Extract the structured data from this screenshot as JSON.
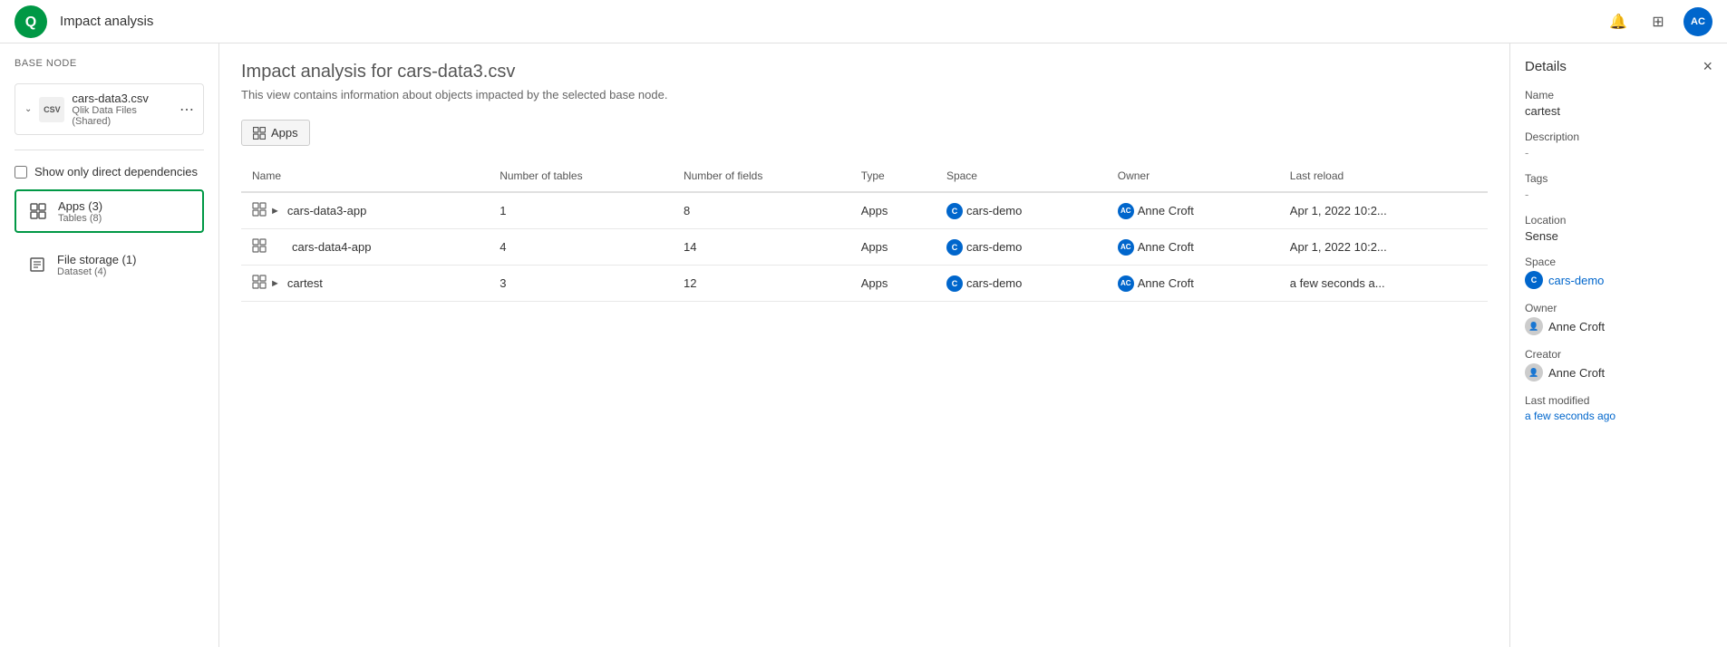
{
  "app": {
    "title": "Impact analysis"
  },
  "topnav": {
    "logo_alt": "Qlik",
    "title": "Impact analysis",
    "avatar_initials": "AC"
  },
  "sidebar": {
    "base_node_label": "Base node",
    "base_node_name": "cars-data3.csv",
    "base_node_sub": "Qlik Data Files (Shared)",
    "checkbox_label": "Show only direct dependencies",
    "nav_items": [
      {
        "title": "Apps  (3)",
        "sub": "Tables (8)",
        "active": true
      },
      {
        "title": "File storage  (1)",
        "sub": "Dataset (4)",
        "active": false
      }
    ]
  },
  "main": {
    "page_title": "Impact analysis for cars-data3.csv",
    "page_subtitle": "This view contains information about objects impacted by the selected base node.",
    "apps_tab_label": "Apps",
    "table": {
      "columns": [
        "Name",
        "Number of tables",
        "Number of fields",
        "Type",
        "Space",
        "Owner",
        "Last reload"
      ],
      "rows": [
        {
          "name": "cars-data3-app",
          "expandable": true,
          "num_tables": "1",
          "num_fields": "8",
          "type": "Apps",
          "space": "cars-demo",
          "space_initial": "C",
          "owner": "Anne Croft",
          "owner_initials": "AC",
          "last_reload": "Apr 1, 2022 10:2..."
        },
        {
          "name": "cars-data4-app",
          "expandable": false,
          "num_tables": "4",
          "num_fields": "14",
          "type": "Apps",
          "space": "cars-demo",
          "space_initial": "C",
          "owner": "Anne Croft",
          "owner_initials": "AC",
          "last_reload": "Apr 1, 2022 10:2..."
        },
        {
          "name": "cartest",
          "expandable": true,
          "num_tables": "3",
          "num_fields": "12",
          "type": "Apps",
          "space": "cars-demo",
          "space_initial": "C",
          "owner": "Anne Croft",
          "owner_initials": "AC",
          "last_reload": "a few seconds a..."
        }
      ]
    }
  },
  "details_panel": {
    "title": "Details",
    "name_label": "Name",
    "name_value": "cartest",
    "description_label": "Description",
    "description_value": "-",
    "tags_label": "Tags",
    "tags_value": "-",
    "location_label": "Location",
    "location_value": "Sense",
    "space_label": "Space",
    "space_value": "cars-demo",
    "space_initial": "C",
    "owner_label": "Owner",
    "owner_value": "Anne Croft",
    "creator_label": "Creator",
    "creator_value": "Anne Croft",
    "last_modified_label": "Last modified",
    "last_modified_value": "a few seconds ago"
  }
}
